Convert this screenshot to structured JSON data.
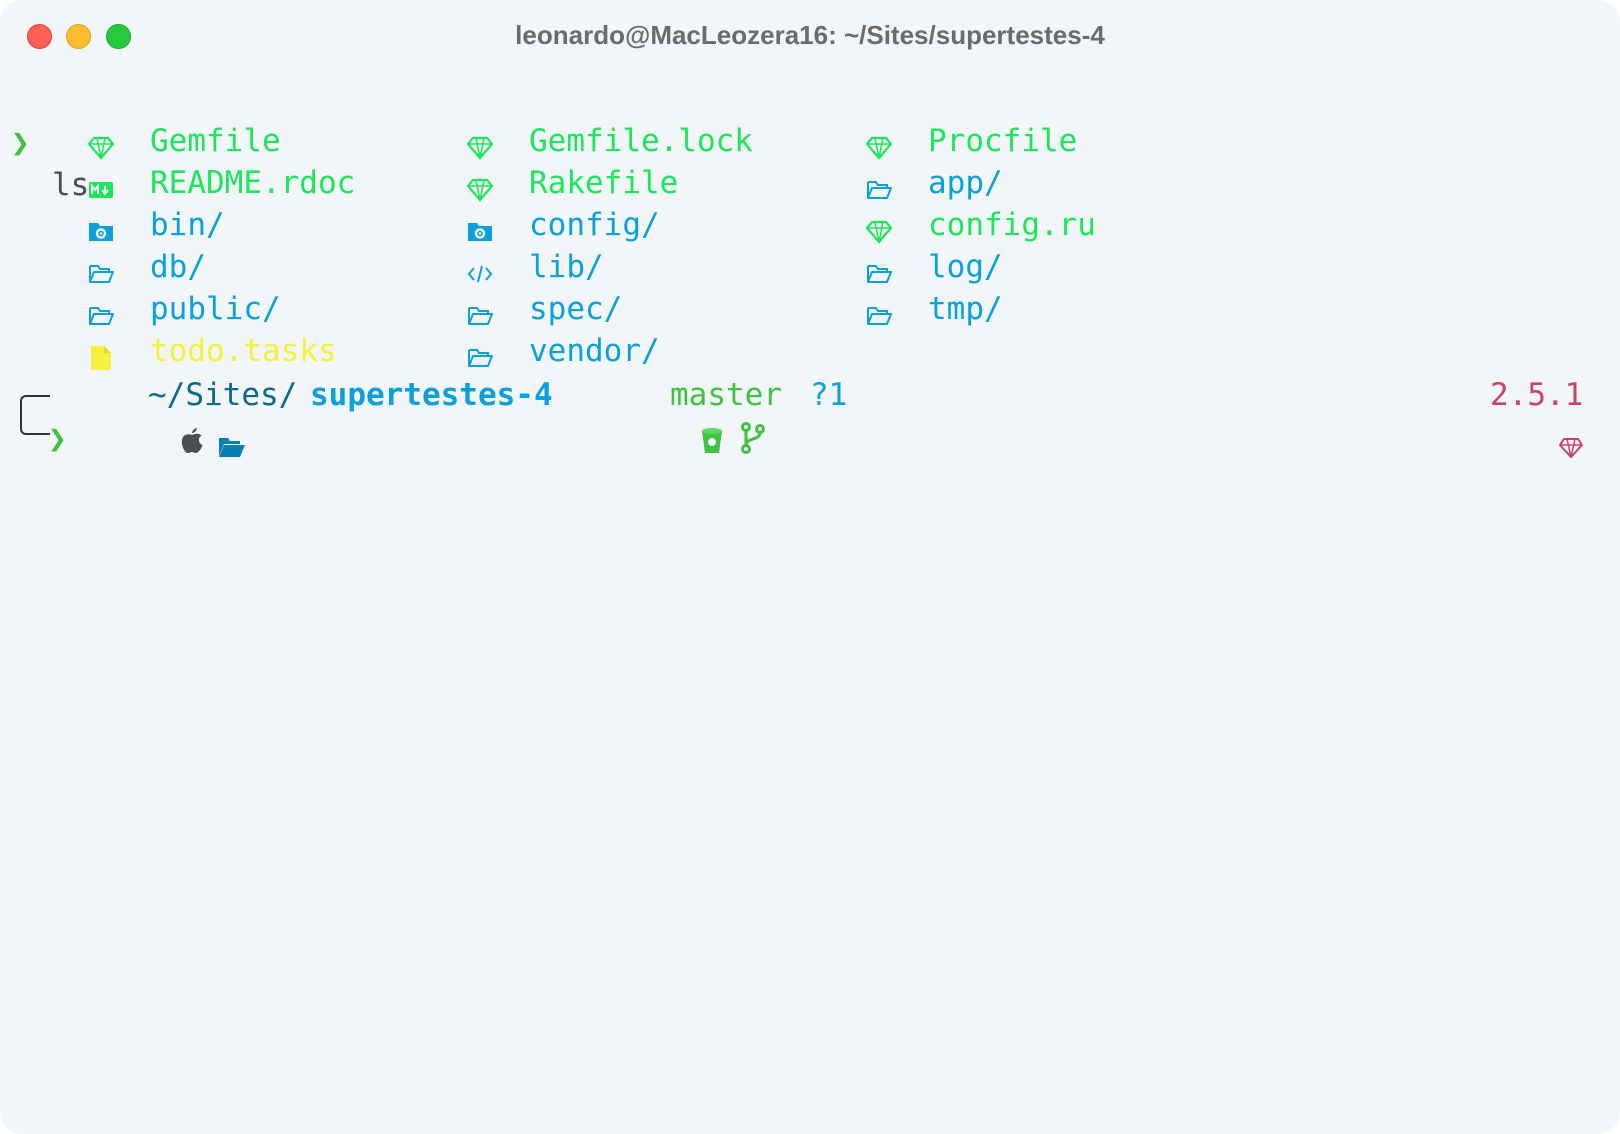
{
  "window": {
    "title": "leonardo@MacLeozera16: ~/Sites/supertestes-4"
  },
  "command": {
    "prompt_glyph": "❯",
    "text": "ls"
  },
  "listing": [
    {
      "name": "Gemfile",
      "icon": "ruby-gem-icon",
      "color": "#1ee65a"
    },
    {
      "name": "Gemfile.lock",
      "icon": "ruby-gem-icon",
      "color": "#1ee65a"
    },
    {
      "name": "Procfile",
      "icon": "ruby-gem-icon",
      "color": "#1ee65a"
    },
    {
      "name": "README.rdoc",
      "icon": "markdown-icon",
      "color": "#1ee65a"
    },
    {
      "name": "Rakefile",
      "icon": "ruby-gem-icon",
      "color": "#1ee65a"
    },
    {
      "name": "app/",
      "icon": "folder-outline-icon",
      "color": "#0aa0dc"
    },
    {
      "name": "bin/",
      "icon": "folder-config-icon",
      "color": "#0aa0dc"
    },
    {
      "name": "config/",
      "icon": "folder-config-icon",
      "color": "#0aa0dc"
    },
    {
      "name": "config.ru",
      "icon": "ruby-gem-icon",
      "color": "#1ee65a"
    },
    {
      "name": "db/",
      "icon": "folder-outline-icon",
      "color": "#0aa0dc"
    },
    {
      "name": "lib/",
      "icon": "code-icon",
      "color": "#0aa0dc"
    },
    {
      "name": "log/",
      "icon": "folder-outline-icon",
      "color": "#0aa0dc"
    },
    {
      "name": "public/",
      "icon": "folder-outline-icon",
      "color": "#0aa0dc"
    },
    {
      "name": "spec/",
      "icon": "folder-outline-icon",
      "color": "#0aa0dc"
    },
    {
      "name": "tmp/",
      "icon": "folder-outline-icon",
      "color": "#0aa0dc"
    },
    {
      "name": "todo.tasks",
      "icon": "file-icon",
      "color": "#f4f13c"
    },
    {
      "name": "vendor/",
      "icon": "folder-outline-icon",
      "color": "#0aa0dc"
    }
  ],
  "prompt": {
    "os_icon": "apple-icon",
    "folder_icon": "folder-open-icon",
    "path_prefix": "~/Sites/",
    "path_dir": "supertestes-4",
    "vcs_icons": [
      "bucket-icon",
      "git-branch-icon"
    ],
    "branch": "master",
    "status": "?1",
    "ruby_icon": "ruby-gem-icon",
    "ruby_version": "2.5.1",
    "input_glyph": "❯"
  },
  "colors": {
    "background": "#f2f6f9",
    "green": "#1ee65a",
    "blue": "#0aa0dc",
    "yellow": "#f4f13c",
    "prompt_green": "#3fc23f",
    "ruby_pink": "#c9426a"
  }
}
